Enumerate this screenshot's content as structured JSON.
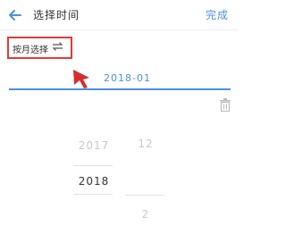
{
  "header": {
    "title": "选择时间",
    "done_label": "完成",
    "accent_color": "#4a90e2"
  },
  "mode": {
    "label": "按月选择",
    "icon": "switch-arrows-icon"
  },
  "date_input": {
    "value": "2018-01"
  },
  "picker": {
    "year_above": "2017",
    "year_selected": "2018",
    "month_above": "12",
    "month_below": "2"
  },
  "icons": {
    "back": "back-arrow-icon",
    "trash": "trash-icon",
    "pointer": "red-pointer-arrow"
  },
  "colors": {
    "highlight_box": "#e53935",
    "pointer_arrow": "#d32f2f"
  }
}
